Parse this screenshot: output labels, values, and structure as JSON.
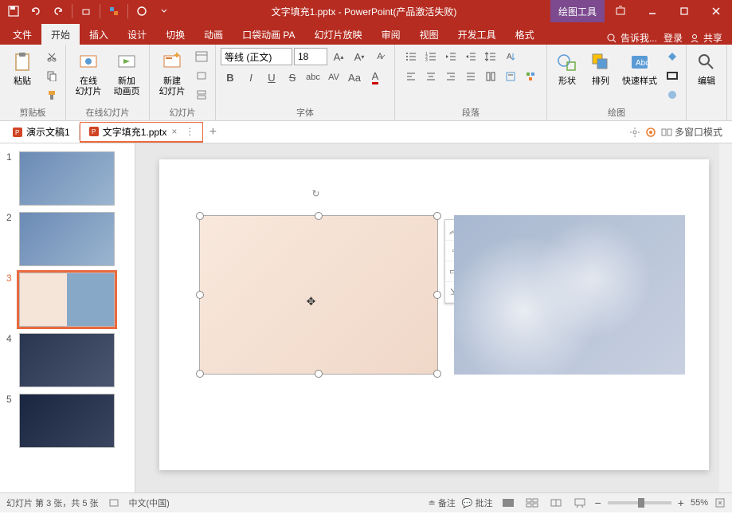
{
  "titlebar": {
    "filename": "文字填充1.pptx",
    "app_suffix": " - PowerPoint(产品激活失败)",
    "tool_context": "绘图工具"
  },
  "tabs": {
    "file": "文件",
    "home": "开始",
    "insert": "插入",
    "design": "设计",
    "transitions": "切换",
    "animations": "动画",
    "pocket": "口袋动画 PA",
    "slideshow": "幻灯片放映",
    "review": "审阅",
    "view": "视图",
    "developer": "开发工具",
    "format": "格式",
    "tell_me": "告诉我...",
    "signin": "登录",
    "share": "共享"
  },
  "ribbon": {
    "clipboard": {
      "paste": "粘贴",
      "label": "剪贴板"
    },
    "slides": {
      "online": "在线\n幻灯片",
      "newanim": "新加\n动画页",
      "newslide": "新建\n幻灯片",
      "label2": "在线幻灯片",
      "label": "幻灯片"
    },
    "font": {
      "name": "等线 (正文)",
      "size": "18",
      "label": "字体"
    },
    "paragraph": {
      "label": "段落"
    },
    "drawing": {
      "shapes": "形状",
      "arrange": "排列",
      "quickstyles": "快速样式",
      "label": "绘图"
    },
    "editing": {
      "edit": "编辑"
    }
  },
  "doctabs": {
    "tab1": "演示文稿1",
    "tab2": "文字填充1.pptx",
    "multiwindow": "多窗口模式"
  },
  "slides": [
    "1",
    "2",
    "3",
    "4",
    "5"
  ],
  "statusbar": {
    "slide_info": "幻灯片 第 3 张，共 5 张",
    "lang": "中文(中国)",
    "notes": "备注",
    "comments": "批注",
    "zoom": "55%"
  }
}
